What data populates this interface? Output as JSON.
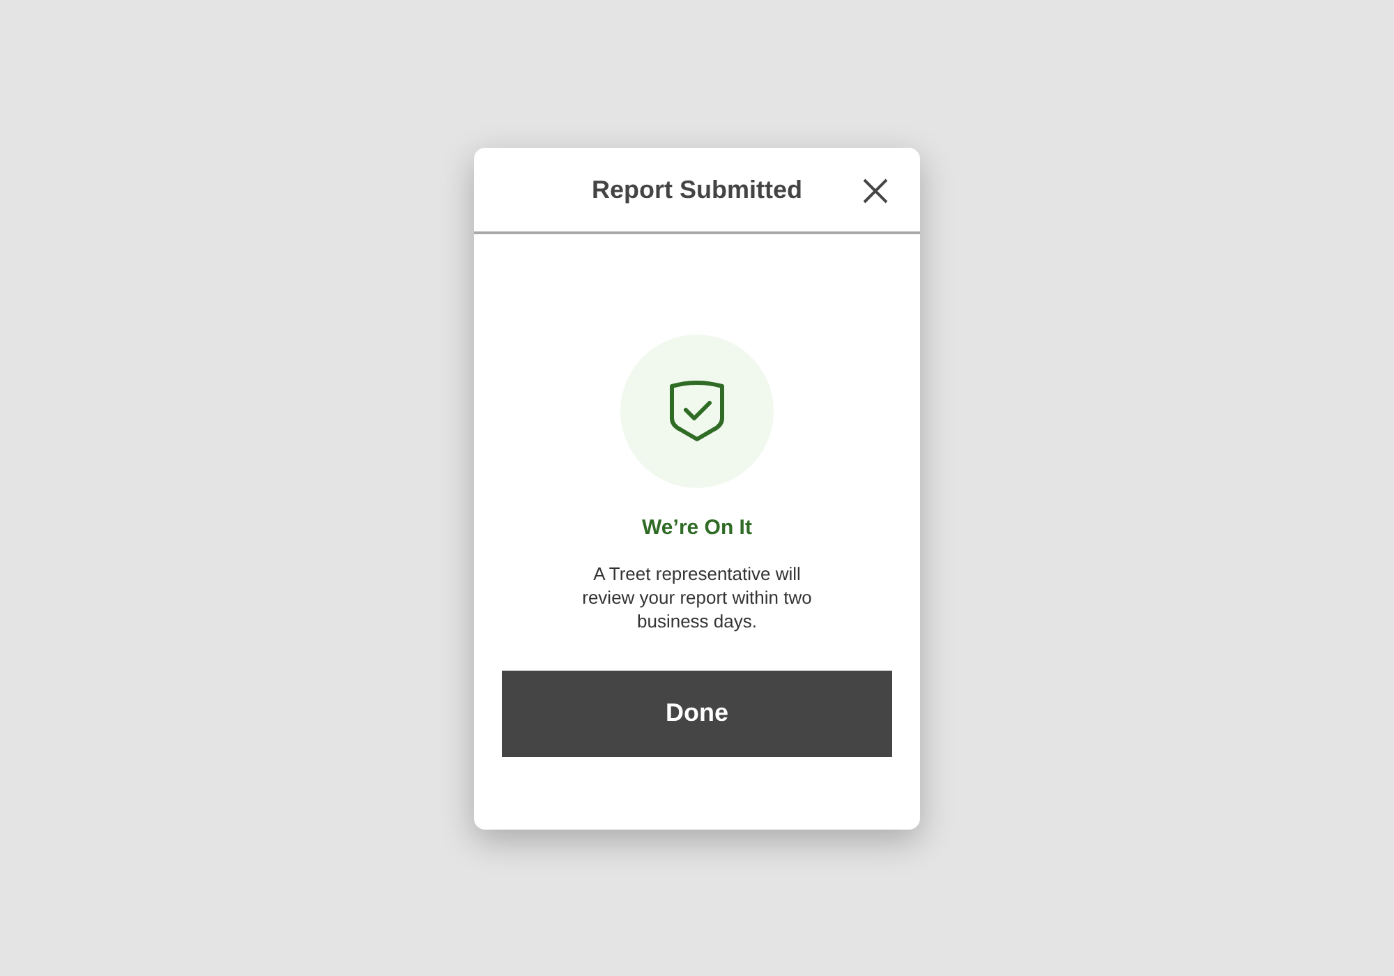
{
  "dialog": {
    "title": "Report Submitted",
    "heading": "We’re On It",
    "message": "A Treet representative will review your report within two business days.",
    "button": "Done"
  }
}
